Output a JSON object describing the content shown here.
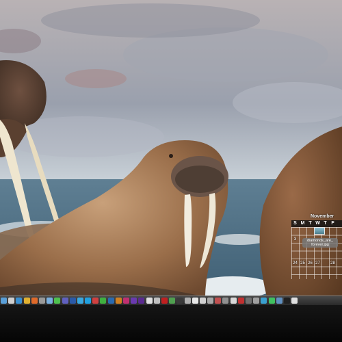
{
  "wallpaper": {
    "subject": "walrus-photo"
  },
  "calendar_widget": {
    "month": "November",
    "weekdays": [
      "S",
      "M",
      "T",
      "W",
      "T",
      "F"
    ],
    "visible_dates": [
      "3",
      "24",
      "25",
      "26",
      "27",
      "28"
    ],
    "file_label": "diamonds_are_forever.jpg",
    "file_label_lines": [
      "diamonds_are_",
      "forever.jpg"
    ]
  },
  "dock": {
    "icons": [
      {
        "name": "finder-icon",
        "color": "#5a9fd8"
      },
      {
        "name": "app-icon-2",
        "color": "#cfcfcf"
      },
      {
        "name": "safari-icon",
        "color": "#3a8fd0"
      },
      {
        "name": "chrome-icon",
        "color": "#e0b030"
      },
      {
        "name": "firefox-icon",
        "color": "#e06a2a"
      },
      {
        "name": "app-icon-6",
        "color": "#9a9a9a"
      },
      {
        "name": "mail-icon",
        "color": "#7ab0e0"
      },
      {
        "name": "messages-icon",
        "color": "#4fc04f"
      },
      {
        "name": "app-icon-9",
        "color": "#6060c0"
      },
      {
        "name": "word-icon",
        "color": "#2a5aa8"
      },
      {
        "name": "twitter-icon",
        "color": "#3aa8e0"
      },
      {
        "name": "skype-icon",
        "color": "#20a0e0"
      },
      {
        "name": "app-icon-13",
        "color": "#d04040"
      },
      {
        "name": "spotify-icon",
        "color": "#40b040"
      },
      {
        "name": "photoshop-icon",
        "color": "#2a6ab0"
      },
      {
        "name": "illustrator-icon",
        "color": "#d08020"
      },
      {
        "name": "indesign-icon",
        "color": "#c03070"
      },
      {
        "name": "after-effects-icon",
        "color": "#6a3ab0"
      },
      {
        "name": "premiere-icon",
        "color": "#5a2a90"
      },
      {
        "name": "app-icon-20",
        "color": "#e0e0e0"
      },
      {
        "name": "app-icon-21",
        "color": "#c0c0c0"
      },
      {
        "name": "filezilla-icon",
        "color": "#c02020"
      },
      {
        "name": "app-icon-23",
        "color": "#50a050"
      },
      {
        "name": "app-icon-24",
        "color": "#3a3a3a"
      },
      {
        "name": "app-icon-25",
        "color": "#b0b0b0"
      },
      {
        "name": "app-icon-26",
        "color": "#e8e8e8"
      },
      {
        "name": "app-icon-27",
        "color": "#d0d0d0"
      },
      {
        "name": "app-icon-28",
        "color": "#a8a8a8"
      },
      {
        "name": "app-icon-29",
        "color": "#c05050"
      },
      {
        "name": "app-icon-30",
        "color": "#909090"
      },
      {
        "name": "app-icon-31",
        "color": "#d8d8d8"
      },
      {
        "name": "app-icon-32",
        "color": "#c03030"
      },
      {
        "name": "app-icon-33",
        "color": "#707070"
      },
      {
        "name": "app-icon-34",
        "color": "#a0a0a0"
      },
      {
        "name": "app-icon-35",
        "color": "#3aa0d0"
      },
      {
        "name": "app-icon-36",
        "color": "#40c060"
      },
      {
        "name": "app-icon-37",
        "color": "#6090c0"
      },
      {
        "name": "app-icon-38",
        "color": "#202020"
      },
      {
        "name": "app-icon-39",
        "color": "#e0e0e0"
      }
    ]
  }
}
